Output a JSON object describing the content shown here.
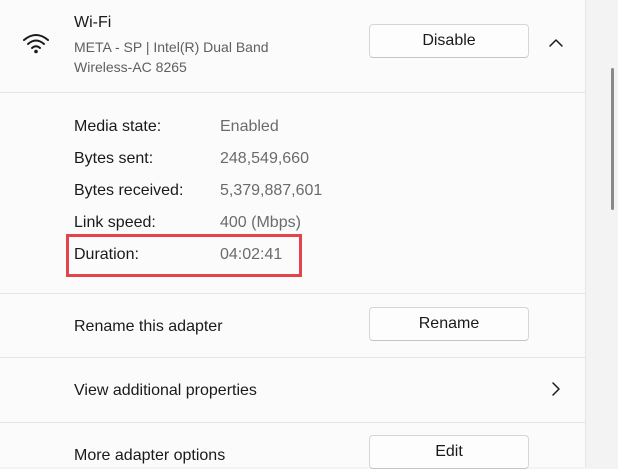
{
  "adapter": {
    "title": "Wi-Fi",
    "subtitle": "META - SP | Intel(R) Dual Band Wireless-AC 8265",
    "disable_label": "Disable",
    "icon": "wifi-icon"
  },
  "properties": [
    {
      "label": "Media state:",
      "value": "Enabled"
    },
    {
      "label": "Bytes sent:",
      "value": "248,549,660"
    },
    {
      "label": "Bytes received:",
      "value": "5,379,887,601"
    },
    {
      "label": "Link speed:",
      "value": "400 (Mbps)"
    },
    {
      "label": "Duration:",
      "value": "04:02:41"
    }
  ],
  "rename": {
    "label": "Rename this adapter",
    "button": "Rename"
  },
  "additional": {
    "label": "View additional properties"
  },
  "more_options": {
    "label": "More adapter options",
    "button": "Edit"
  },
  "colors": {
    "highlight": "#e3444b"
  }
}
